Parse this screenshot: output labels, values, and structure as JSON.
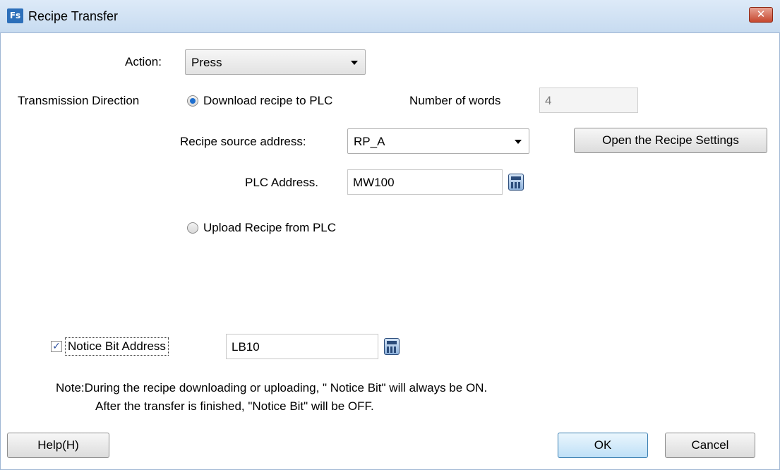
{
  "window": {
    "app_icon_text": "Fs",
    "title": "Recipe Transfer",
    "close_symbol": "✕"
  },
  "action": {
    "label": "Action:",
    "value": "Press"
  },
  "transmission": {
    "label": "Transmission Direction",
    "download_label": "Download recipe to PLC",
    "download_selected": true,
    "upload_label": "Upload Recipe from PLC",
    "upload_selected": false,
    "words_label": "Number of words",
    "words_value": "4"
  },
  "recipe_source": {
    "label": "Recipe source address:",
    "value": "RP_A",
    "open_settings_label": "Open the Recipe Settings"
  },
  "plc_address": {
    "label": "PLC Address.",
    "value": "MW100"
  },
  "notice": {
    "checked": true,
    "check_mark": "✓",
    "label": "Notice Bit Address",
    "value": "LB10"
  },
  "note": {
    "line1": "Note:During the recipe downloading or uploading, \" Notice Bit\" will always be ON.",
    "line2": "After the transfer is finished, \"Notice Bit\" will be OFF."
  },
  "buttons": {
    "help": "Help(H)",
    "ok": "OK",
    "cancel": "Cancel"
  },
  "icons": {
    "app": "fs-app-icon",
    "close": "close-icon",
    "calculator": "calculator-icon",
    "dropdown": "chevron-down-icon"
  },
  "colors": {
    "titlebar": "#c7dbf0",
    "close_button": "#c6472e",
    "radio_selected": "#1e6fcf",
    "default_button_border": "#3c7fb1"
  }
}
